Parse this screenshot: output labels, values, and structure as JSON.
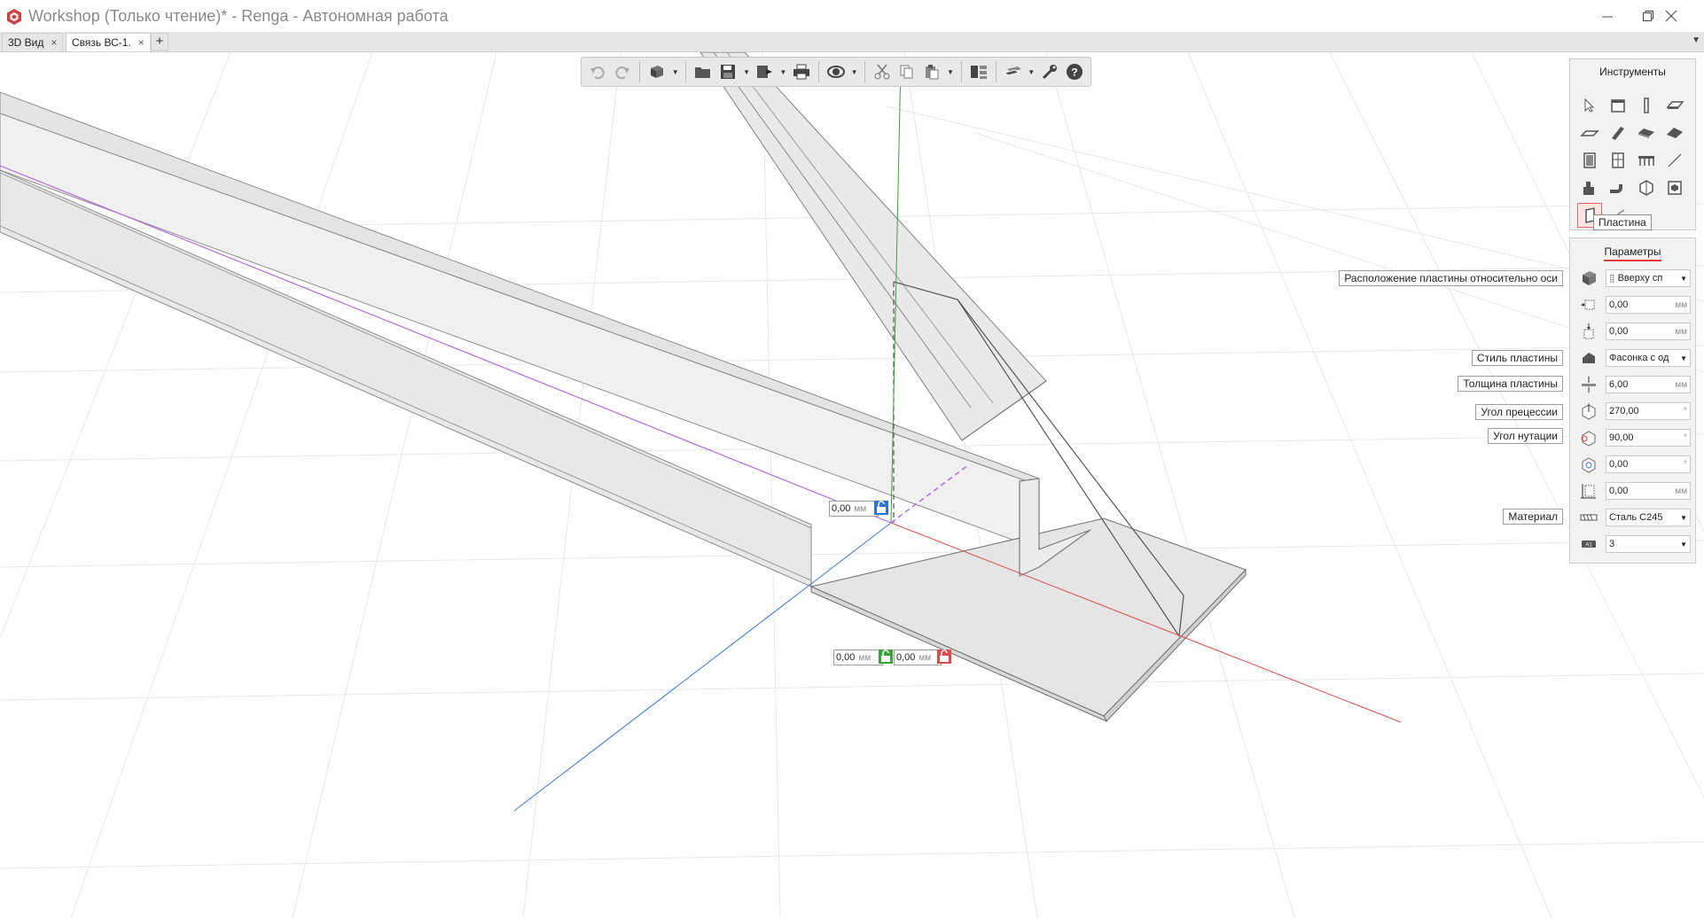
{
  "window": {
    "title": "Workshop (Только чтение)* - Renga - Автономная работа",
    "colors": {
      "title_text": "#8a8a8a",
      "accent_red": "#e03c3c"
    }
  },
  "tabs": [
    {
      "label": "3D Вид",
      "active": false
    },
    {
      "label": "Связь ВС-1.",
      "active": true
    }
  ],
  "toolbar": {
    "icons": [
      "undo-icon",
      "redo-icon",
      "view-cube-icon",
      "open-folder-icon",
      "save-icon",
      "export-icon",
      "print-icon",
      "orbit-icon",
      "cut-icon",
      "copy-icon",
      "paste-icon",
      "layers-icon",
      "views-icon",
      "wrench-icon",
      "help-icon"
    ]
  },
  "tools_panel": {
    "title": "Инструменты",
    "tooltip": "Пластина",
    "items": [
      "select",
      "wall",
      "column",
      "slab",
      "floor",
      "beam",
      "stair",
      "roof",
      "door",
      "window",
      "railing",
      "line",
      "equipment",
      "pipe",
      "element",
      "assembly",
      "plate",
      "rib"
    ]
  },
  "params_panel": {
    "title": "Параметры",
    "rows": [
      {
        "label": "Расположение пластины относительно оси",
        "value": "Вверху сп",
        "unit": "",
        "dropdown": true,
        "icon": "plate-position-icon"
      },
      {
        "label": "",
        "value": "0,00",
        "unit": "мм",
        "dropdown": false,
        "icon": "offset-x-icon"
      },
      {
        "label": "",
        "value": "0,00",
        "unit": "мм",
        "dropdown": false,
        "icon": "offset-y-icon"
      },
      {
        "label": "Стиль пластины",
        "value": "Фасонка с од",
        "unit": "",
        "dropdown": true,
        "icon": "plate-style-icon"
      },
      {
        "label": "Толщина пластины",
        "value": "6,00",
        "unit": "мм",
        "dropdown": false,
        "icon": "thickness-icon"
      },
      {
        "label": "Угол прецессии",
        "value": "270,00",
        "unit": "°",
        "dropdown": false,
        "icon": "precession-icon"
      },
      {
        "label": "Угол нутации",
        "value": "90,00",
        "unit": "°",
        "dropdown": false,
        "icon": "nutation-icon"
      },
      {
        "label": "",
        "value": "0,00",
        "unit": "°",
        "dropdown": false,
        "icon": "rotation-icon"
      },
      {
        "label": "",
        "value": "0,00",
        "unit": "мм",
        "dropdown": false,
        "icon": "elevation-icon"
      },
      {
        "label": "Материал",
        "value": "Сталь С245",
        "unit": "",
        "dropdown": true,
        "icon": "material-icon"
      },
      {
        "label": "",
        "value": "3",
        "unit": "",
        "dropdown": true,
        "icon": "mark-icon"
      }
    ]
  },
  "viewport_inputs": {
    "z": {
      "value": "0,00",
      "unit": "мм"
    },
    "y": {
      "value": "0,00",
      "unit": "мм"
    },
    "x": {
      "value": "0,00",
      "unit": "мм"
    }
  }
}
